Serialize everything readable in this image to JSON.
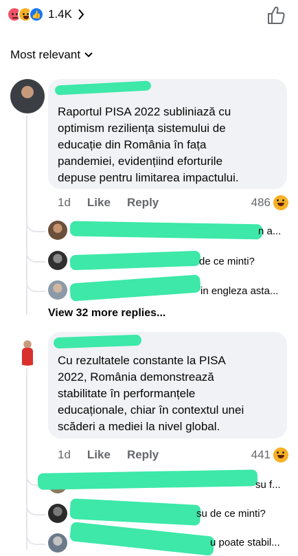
{
  "reactions": {
    "count": "1.4K",
    "icons": [
      "angry-emoji",
      "haha-emoji",
      "like-emoji"
    ]
  },
  "sort": {
    "label": "Most relevant"
  },
  "comments": [
    {
      "text": "Raportul PISA 2022 subliniază cu\noptimism reziliența sistemului de\neducație din România în fața\npandemiei, evidențiind eforturile\ndepuse pentru limitarea impactului.",
      "time": "1d",
      "like_label": "Like",
      "reply_label": "Reply",
      "reaction_count": "486",
      "replies": [
        {
          "text": "n a..."
        },
        {
          "text": "de ce minti?"
        },
        {
          "text": "in engleza asta..."
        }
      ],
      "view_more": "View 32 more replies..."
    },
    {
      "text": "Cu rezultatele constante la PISA\n2022, România demonstrează\nstabilitate în performanțele\neducaționale, chiar în contextul unei\nscăderi a mediei la nivel global.",
      "time": "1d",
      "like_label": "Like",
      "reply_label": "Reply",
      "reaction_count": "441",
      "replies": [
        {
          "text": "su f..."
        },
        {
          "text": "su de ce minti?"
        },
        {
          "text": "u poate stabil..."
        }
      ]
    }
  ],
  "colors": {
    "bubble": "#f0f2f5",
    "secondary_text": "#65676b",
    "redaction": "#3de8a8",
    "like_blue": "#1877f2"
  }
}
